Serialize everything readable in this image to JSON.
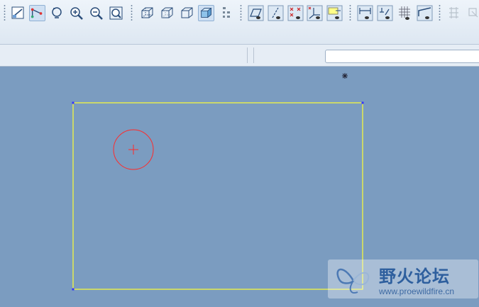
{
  "toolbar": {
    "buttons": [
      {
        "name": "sketch-setup-icon"
      },
      {
        "name": "sketch-tool-icon",
        "active": true
      },
      {
        "name": "repaint-icon"
      },
      {
        "name": "zoom-in-icon"
      },
      {
        "name": "zoom-out-icon"
      },
      {
        "name": "refit-icon"
      },
      {
        "name": "wireframe-icon"
      },
      {
        "name": "hidden-line-icon"
      },
      {
        "name": "no-hidden-icon"
      },
      {
        "name": "shading-icon",
        "active": true
      },
      {
        "name": "model-tree-icon"
      },
      {
        "name": "datum-planes-icon"
      },
      {
        "name": "datum-axes-icon"
      },
      {
        "name": "datum-points-icon"
      },
      {
        "name": "coordinate-systems-icon"
      },
      {
        "name": "annotation-icon"
      },
      {
        "name": "dimension-display-icon"
      },
      {
        "name": "constraint-display-icon"
      },
      {
        "name": "grid-display-icon"
      },
      {
        "name": "vertex-display-icon"
      },
      {
        "name": "disabled-tool-1-icon"
      },
      {
        "name": "disabled-tool-2-icon"
      }
    ]
  },
  "command_input": {
    "value": ""
  },
  "sketch": {
    "line_color": "#ffff33",
    "circle_color": "#ff2a2a",
    "vertex_color": "#3333ff"
  },
  "watermark": {
    "title": "野火论坛",
    "url": "www.proewildfire.cn"
  }
}
